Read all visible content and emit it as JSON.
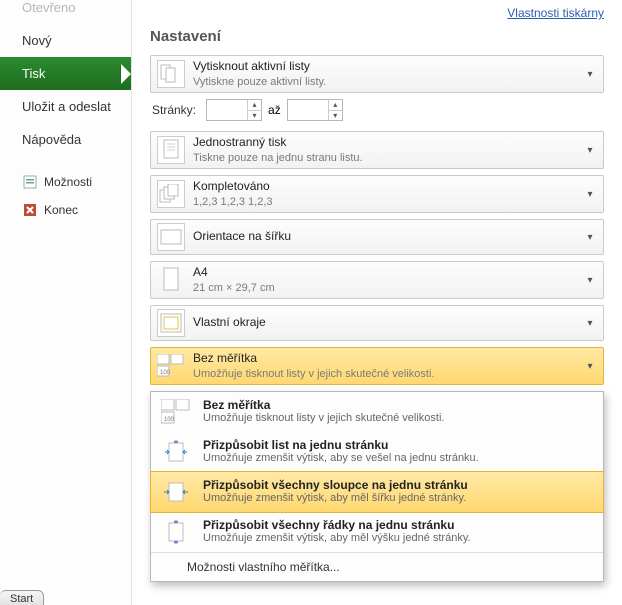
{
  "sidebar": {
    "items": [
      "Otevřeno",
      "Nový",
      "Tisk",
      "Uložit a odeslat",
      "Nápověda"
    ],
    "links": [
      "Možnosti",
      "Konec"
    ]
  },
  "printer_props": "Vlastnosti tiskárny",
  "settings_title": "Nastavení",
  "opts": {
    "print_active": {
      "title": "Vytisknout aktivní listy",
      "sub": "Vytiskne pouze aktivní listy."
    },
    "pages_label": "Stránky:",
    "pages_to": "až",
    "one_sided": {
      "title": "Jednostranný tisk",
      "sub": "Tiskne pouze na jednu stranu listu."
    },
    "collated": {
      "title": "Kompletováno",
      "sub": "1,2,3    1,2,3    1,2,3"
    },
    "orientation": {
      "title": "Orientace na šířku"
    },
    "paper": {
      "title": "A4",
      "sub": "21 cm × 29,7 cm"
    },
    "margins": {
      "title": "Vlastní okraje"
    },
    "scaling": {
      "title": "Bez měřítka",
      "sub": "Umožňuje tisknout listy v jejich skutečné velikosti."
    }
  },
  "scaling_menu": {
    "items": [
      {
        "t": "Bez měřítka",
        "s": "Umožňuje tisknout listy v jejich skutečné velikosti."
      },
      {
        "t": "Přizpůsobit list na jednu stránku",
        "s": "Umožňuje zmenšit výtisk, aby se vešel na jednu stránku."
      },
      {
        "t": "Přizpůsobit všechny sloupce na jednu stránku",
        "s": "Umožňuje zmenšit výtisk, aby měl šířku jedné stránky."
      },
      {
        "t": "Přizpůsobit všechny řádky na jednu stránku",
        "s": "Umožňuje zmenšit výtisk, aby měl výšku jedné stránky."
      }
    ],
    "footer": "Možnosti vlastního měřítka..."
  },
  "start": "Start"
}
